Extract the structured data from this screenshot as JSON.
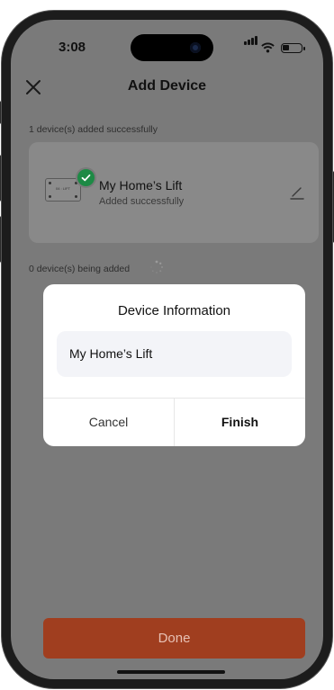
{
  "status_bar": {
    "time": "3:08"
  },
  "nav": {
    "title": "Add Device",
    "close_icon": "close-icon"
  },
  "added_section": {
    "label": "1 device(s) added successfully",
    "device": {
      "name": "My Home’s Lift",
      "status": "Added successfully",
      "image_label": "04 : LIFT"
    }
  },
  "adding_section": {
    "label": "0 device(s) being added"
  },
  "dialog": {
    "title": "Device Information",
    "input_value": "My Home’s Lift",
    "cancel_label": "Cancel",
    "finish_label": "Finish"
  },
  "done_button": {
    "label": "Done"
  },
  "colors": {
    "accent": "#a03e1f",
    "success": "#1d8a45",
    "overlay": "#7a7a7a"
  }
}
